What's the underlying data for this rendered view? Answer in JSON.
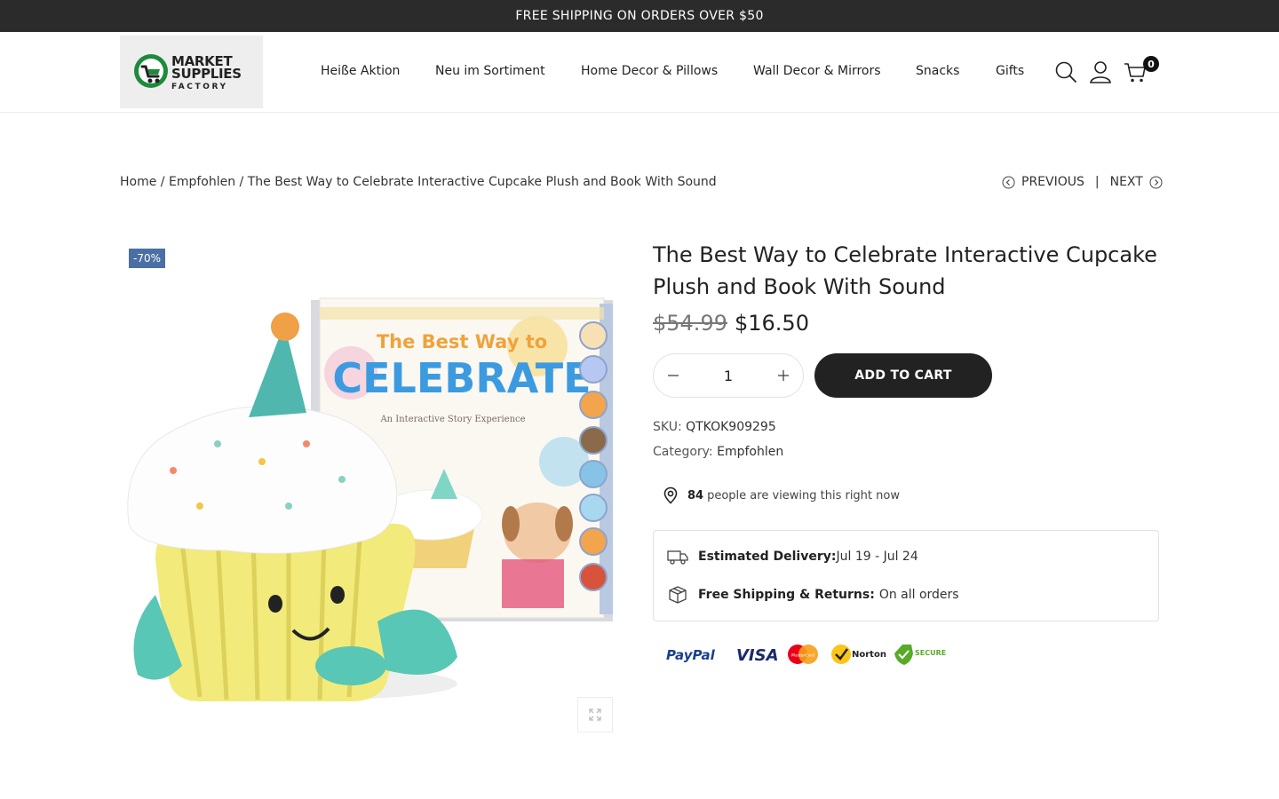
{
  "announcement": "FREE SHIPPING ON ORDERS OVER $50",
  "logo": {
    "line1": "MARKET",
    "line2": "SUPPLIES",
    "line3": "FACTORY"
  },
  "nav": [
    "Heiße Aktion",
    "Neu im Sortiment",
    "Home Decor & Pillows",
    "Wall Decor & Mirrors",
    "Snacks",
    "Gifts"
  ],
  "header_icons": [
    "search-icon",
    "user-icon",
    "cart-icon"
  ],
  "cart_count": "0",
  "breadcrumb": {
    "home": "Home",
    "sep": "/",
    "category": "Empfohlen",
    "current": "The Best Way to Celebrate Interactive Cupcake Plush and Book With Sound"
  },
  "pager": {
    "previous": "PREVIOUS",
    "divider": "|",
    "next": "NEXT"
  },
  "product": {
    "badge": "-70%",
    "title": "The Best Way to Celebrate Interactive Cupcake Plush and Book With Sound",
    "old_price": "$54.99",
    "price": "$16.50",
    "quantity": "1",
    "add_to_cart": "ADD TO CART",
    "sku_label": "SKU:",
    "sku": "QTKOK909295",
    "category_label": "Category:",
    "category": "Empfohlen",
    "viewing_count": "84",
    "viewing_text": "people are viewing this right now",
    "image_book_title_1": "The Best Way to",
    "image_book_title_2": "CELEBRATE",
    "image_book_subtitle": "An Interactive Story Experience"
  },
  "delivery": {
    "est_label": "Estimated Delivery:",
    "est_value": "Jul 19 - Jul 24",
    "ship_label": "Free Shipping & Returns:",
    "ship_value": "On all orders"
  },
  "payments": {
    "paypal": "PayPal",
    "visa": "VISA",
    "mastercard": "MasterCard",
    "norton": "Norton",
    "secure": "SECURE"
  },
  "colors": {
    "topbar": "#2b2b2b",
    "badge": "#4a6fa5",
    "button": "#222222",
    "logo_green": "#1f8a3c"
  }
}
